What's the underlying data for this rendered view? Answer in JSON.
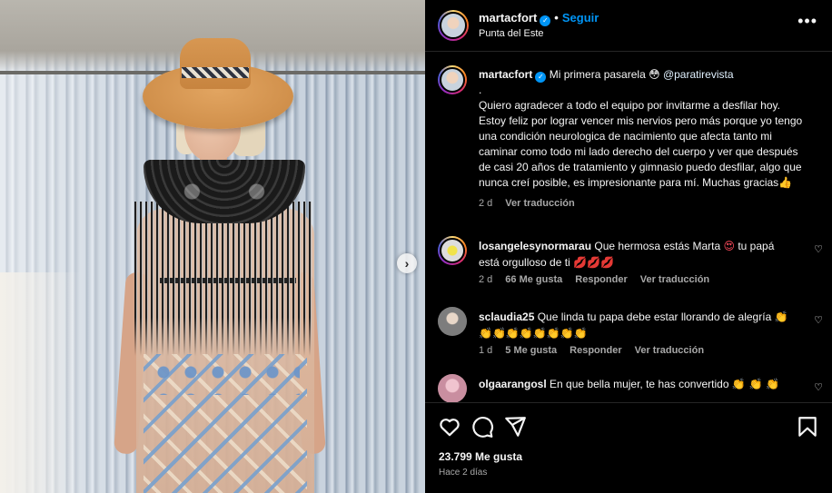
{
  "post": {
    "username": "martacfort",
    "follow_label": "Seguir",
    "location": "Punta del Este",
    "more_label": "•••"
  },
  "caption": {
    "username": "martacfort",
    "title": "Mi primera pasarela",
    "title_emoji": "😳",
    "mention": "@paratirevista",
    "dot": ".",
    "body": "Quiero agradecer a todo el equipo por invitarme a desfilar hoy. Estoy feliz por lograr vencer mis nervios pero más porque yo tengo una condición neurologica de nacimiento que afecta tanto mi caminar como todo mi lado derecho del cuerpo y ver que después de casi 20 años de tratamiento y gimnasio puedo desfilar, algo que nunca creí posible, es impresionante para mí. Muchas gracias",
    "end_emoji": "👍",
    "time": "2 d",
    "translate": "Ver traducción"
  },
  "comments": [
    {
      "username": "losangelesynormarau",
      "text": "Que hermosa estás Marta",
      "emoji_1": "😍",
      "text_2": "tu papá está orgulloso de ti",
      "emoji_2": "💋💋💋",
      "time": "2 d",
      "likes": "66 Me gusta",
      "reply": "Responder",
      "translate": "Ver traducción"
    },
    {
      "username": "sclaudia25",
      "text": "Que linda tu papa debe estar llorando de alegría",
      "emoji_1": "👏",
      "emoji_2": "👏👏👏👏👏👏👏👏",
      "time": "1 d",
      "likes": "5 Me gusta",
      "reply": "Responder",
      "translate": "Ver traducción"
    },
    {
      "username": "olgaarangosl",
      "text": "En que bella mujer, te has convertido",
      "emoji_1": "👏 👏 👏"
    }
  ],
  "footer": {
    "likes": "23.799 Me gusta",
    "ago": "Hace 2 días"
  },
  "icons": [
    "more-icon",
    "verified-icon",
    "heart-icon",
    "comment-icon",
    "share-icon",
    "bookmark-icon",
    "chevron-right-icon"
  ],
  "colors": {
    "accent": "#0095f6",
    "background": "#000000",
    "text": "#f5f5f5",
    "muted": "#a8a8a8"
  }
}
